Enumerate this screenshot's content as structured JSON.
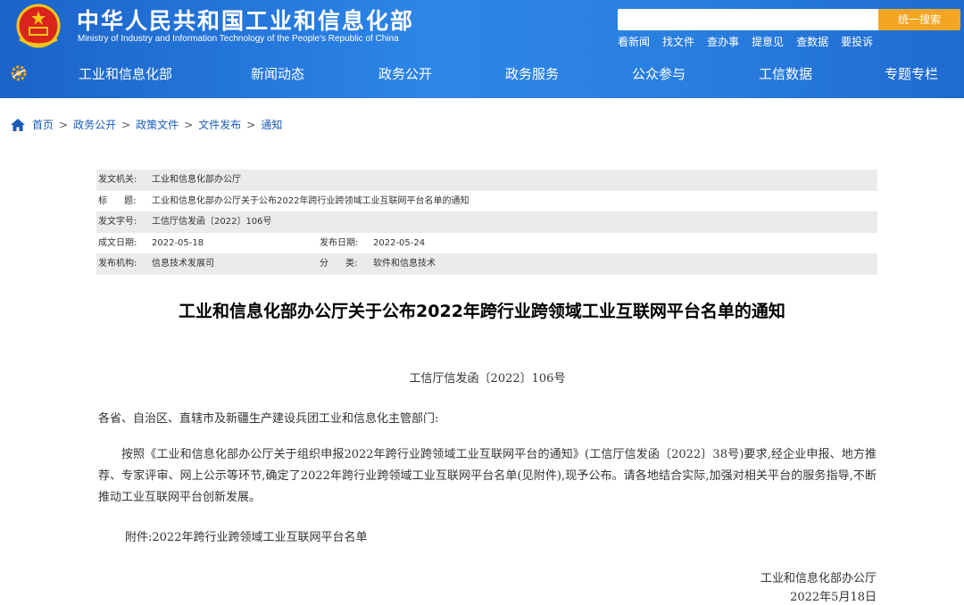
{
  "header": {
    "site_name_cn": "中华人民共和国工业和信息化部",
    "site_name_en": "Ministry of Industry and Information Technology of the People's Republic of China",
    "search": {
      "placeholder": "",
      "button_label": "统一搜索"
    },
    "quick_links": [
      "看新闻",
      "找文件",
      "查办事",
      "提意见",
      "查数据",
      "要投诉"
    ],
    "nav": [
      "工业和信息化部",
      "新闻动态",
      "政务公开",
      "政务服务",
      "公众参与",
      "工信数据",
      "专题专栏"
    ],
    "colors": {
      "bar_start": "#1b63c9",
      "bar_end": "#2d86e8",
      "search_button": "#f2a623"
    }
  },
  "breadcrumb": [
    "首页",
    "政务公开",
    "政策文件",
    "文件发布",
    "通知"
  ],
  "info_table": {
    "issuer_label": "发文机关:",
    "issuer": "工业和信息化部办公厅",
    "title_label": "标      题:",
    "title": "工业和信息化部办公厅关于公布2022年跨行业跨领域工业互联网平台名单的通知",
    "doc_no_label": "发文字号:",
    "doc_no": "工信厅信发函〔2022〕106号",
    "created_label": "成文日期:",
    "created": "2022-05-18",
    "published_label": "发布日期:",
    "published": "2022-05-24",
    "publisher_label": "发布机构:",
    "publisher": "信息技术发展司",
    "category_label": "分      类:",
    "category": "软件和信息技术"
  },
  "document": {
    "title": "工业和信息化部办公厅关于公布2022年跨行业跨领域工业互联网平台名单的通知",
    "number": "工信厅信发函〔2022〕106号",
    "salutation": "各省、自治区、直辖市及新疆生产建设兵团工业和信息化主管部门:",
    "body": "按照《工业和信息化部办公厅关于组织申报2022年跨行业跨领域工业互联网平台的通知》(工信厅信发函〔2022〕38号)要求,经企业申报、地方推荐、专家评审、网上公示等环节,确定了2022年跨行业跨领域工业互联网平台名单(见附件),现予公布。请各地结合实际,加强对相关平台的服务指导,不断推动工业互联网平台创新发展。",
    "attachment": "附件:2022年跨行业跨领域工业互联网平台名单",
    "signer": "工业和信息化部办公厅",
    "date": "2022年5月18日"
  }
}
